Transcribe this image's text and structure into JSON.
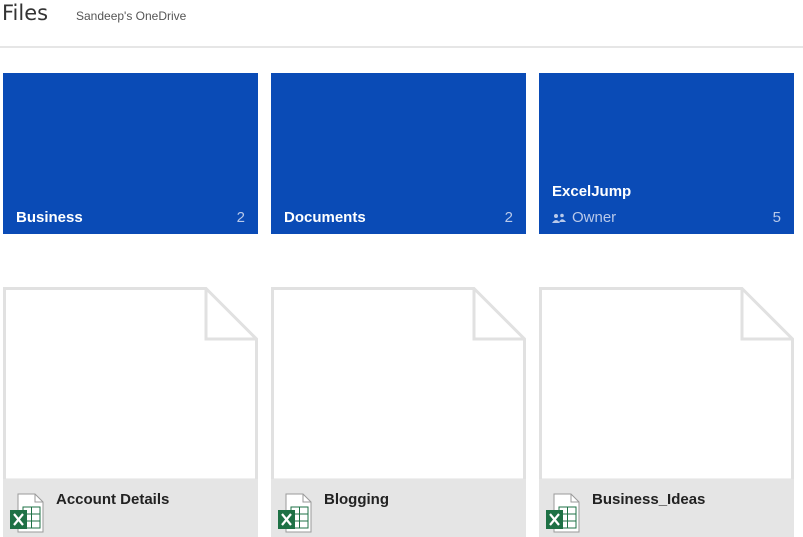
{
  "header": {
    "title": "Files",
    "subtitle": "Sandeep's OneDrive"
  },
  "folders": [
    {
      "name": "Business",
      "count": "2"
    },
    {
      "name": "Documents",
      "count": "2"
    },
    {
      "name": "ExcelJump",
      "role": "Owner",
      "count": "5"
    }
  ],
  "files": [
    {
      "name": "Account Details",
      "icon": "excel-file-icon"
    },
    {
      "name": "Blogging",
      "icon": "excel-file-icon"
    },
    {
      "name": "Business_Ideas",
      "icon": "excel-file-icon"
    }
  ],
  "colors": {
    "folder_tile": "#0a4bb6",
    "file_footer": "#e5e5e5",
    "excel_green": "#1e7145"
  }
}
